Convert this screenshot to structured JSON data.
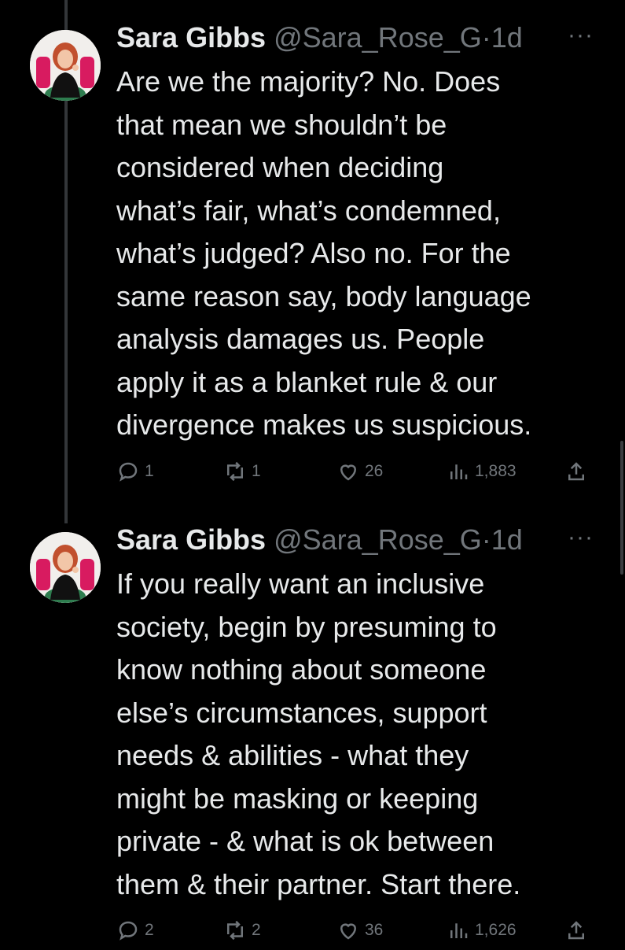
{
  "tweets": [
    {
      "name": "Sara Gibbs",
      "handle": "@Sara_Rose_G",
      "dot": "·",
      "time": "1d",
      "more": "···",
      "text": "Are we the majority? No. Does\nthat mean we shouldn’t be\nconsidered when deciding\nwhat’s fair, what’s condemned,\nwhat’s judged? Also no. For the\nsame reason say, body language\nanalysis damages us. People\napply it as a blanket rule & our\ndivergence makes us suspicious.",
      "replies": "1",
      "retweets": "1",
      "likes": "26",
      "views": "1,883"
    },
    {
      "name": "Sara Gibbs",
      "handle": "@Sara_Rose_G",
      "dot": "·",
      "time": "1d",
      "more": "···",
      "text": "If you really want an inclusive\nsociety, begin by presuming to\nknow nothing about someone\nelse’s circumstances, support\nneeds & abilities - what they\nmight be masking or keeping\nprivate - & what is ok between\nthem & their partner. Start there.",
      "replies": "2",
      "retweets": "2",
      "likes": "36",
      "views": "1,626"
    }
  ],
  "colors": {
    "background": "#000000",
    "text": "#e7e9ea",
    "muted": "#71767b",
    "thread_line": "#333639"
  }
}
